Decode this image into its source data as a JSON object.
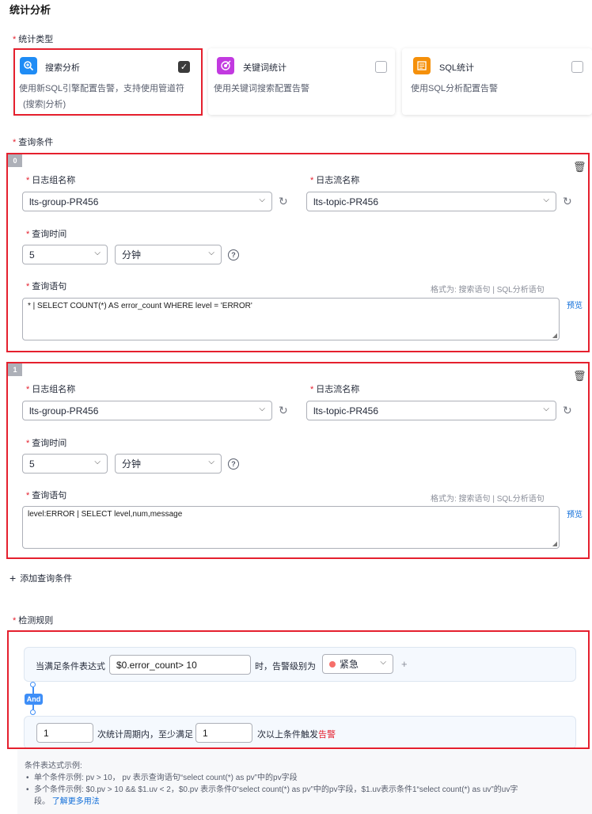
{
  "page_title": "统计分析",
  "stat_type": {
    "label": "统计类型",
    "cards": [
      {
        "title": "搜索分析",
        "desc_line1": "使用新SQL引擎配置告警，支持使用管道符",
        "desc_line2": "(搜索|分析)",
        "checked": true,
        "icon": "search-analysis-icon",
        "color": "#1f8cf5"
      },
      {
        "title": "关键词统计",
        "desc_line1": "使用关键词搜索配置告警",
        "checked": false,
        "icon": "keyword-target-icon",
        "color": "#c23ae0"
      },
      {
        "title": "SQL统计",
        "desc_line1": "使用SQL分析配置告警",
        "checked": false,
        "icon": "sql-icon",
        "color": "#f5900a"
      }
    ]
  },
  "query_conditions": {
    "label": "查询条件",
    "items": [
      {
        "index": "0",
        "group_label": "日志组名称",
        "group_value": "lts-group-PR456",
        "stream_label": "日志流名称",
        "stream_value": "lts-topic-PR456",
        "time_label": "查询时间",
        "time_value": "5",
        "time_unit": "分钟",
        "stmt_label": "查询语句",
        "format_hint": "格式为:  搜索语句 | SQL分析语句",
        "statement": "* | SELECT COUNT(*) AS error_count WHERE level = 'ERROR'",
        "preview": "预览"
      },
      {
        "index": "1",
        "group_label": "日志组名称",
        "group_value": "lts-group-PR456",
        "stream_label": "日志流名称",
        "stream_value": "lts-topic-PR456",
        "time_label": "查询时间",
        "time_value": "5",
        "time_unit": "分钟",
        "stmt_label": "查询语句",
        "format_hint": "格式为:  搜索语句 | SQL分析语句",
        "statement": "level:ERROR | SELECT level,num,message",
        "preview": "预览"
      }
    ],
    "add_label": "添加查询条件"
  },
  "detection": {
    "label": "检测规则",
    "condition_prefix": "当满足条件表达式",
    "expression": "$0.error_count> 10",
    "condition_mid": "时，告警级别为",
    "severity": "紧急",
    "severity_color": "#f66f6a",
    "and_label": "And",
    "period_value": "1",
    "period_mid": "次统计周期内，至少满足",
    "count_value": "1",
    "period_suffix": "次以上条件触发",
    "alarm_word": "告警"
  },
  "examples": {
    "title": "条件表达式示例:",
    "single": "单个条件示例:  pv > 10， pv 表示查询语句“select count(*) as pv”中的pv字段",
    "multi_line1": "多个条件示例:  $0.pv > 10 && $1.uv < 2，$0.pv 表示条件0“select count(*) as pv”中的pv字段，$1.uv表示条件1“select count(*) as uv”的uv字",
    "multi_line2": "段。",
    "learn_more": "了解更多用法"
  }
}
